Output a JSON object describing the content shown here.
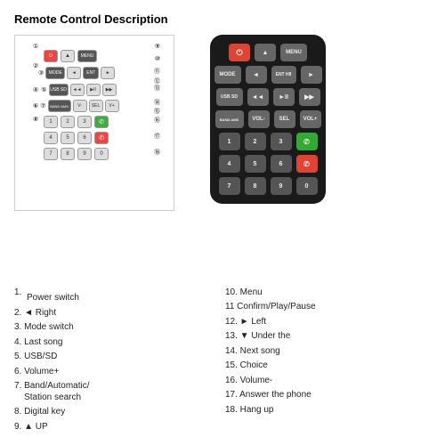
{
  "title": "Remote Control Description",
  "descriptions": {
    "left": [
      {
        "num": "1.",
        "text": "Power switch"
      },
      {
        "num": "2.",
        "text": "◄ Right"
      },
      {
        "num": "3.",
        "text": "Mode switch"
      },
      {
        "num": "4.",
        "text": "Last song"
      },
      {
        "num": "5.",
        "text": "USB/SD"
      },
      {
        "num": "6.",
        "text": "Volume+"
      },
      {
        "num": "7.",
        "text": "Band/Automatic/\nStation search"
      },
      {
        "num": "8.",
        "text": "Digital key"
      },
      {
        "num": "9.",
        "text": "▲ UP"
      }
    ],
    "right": [
      {
        "num": "10.",
        "text": "Menu"
      },
      {
        "num": "11",
        "text": "Confirm/Play/Pause"
      },
      {
        "num": "12.",
        "text": "► Left"
      },
      {
        "num": "13.",
        "text": "▼ Under the"
      },
      {
        "num": "14.",
        "text": "Next song"
      },
      {
        "num": "15.",
        "text": "Choice"
      },
      {
        "num": "16.",
        "text": "Volume-"
      },
      {
        "num": "17.",
        "text": "Answer the phone"
      },
      {
        "num": "18.",
        "text": "Hang up"
      }
    ]
  },
  "remote_rows": [
    [
      "PWR",
      "▲",
      "MENU"
    ],
    [
      "MODE",
      "◄",
      "ENT HII",
      "►"
    ],
    [
      "USB SD",
      "◄◄",
      "►II",
      "▶▶"
    ],
    [
      "BAND AMS",
      "VOL-",
      "SEL",
      "VOL+"
    ],
    [
      "1",
      "2",
      "3",
      "✆"
    ],
    [
      "4",
      "5",
      "6",
      "✆"
    ],
    [
      "7",
      "8",
      "9",
      "0"
    ]
  ]
}
